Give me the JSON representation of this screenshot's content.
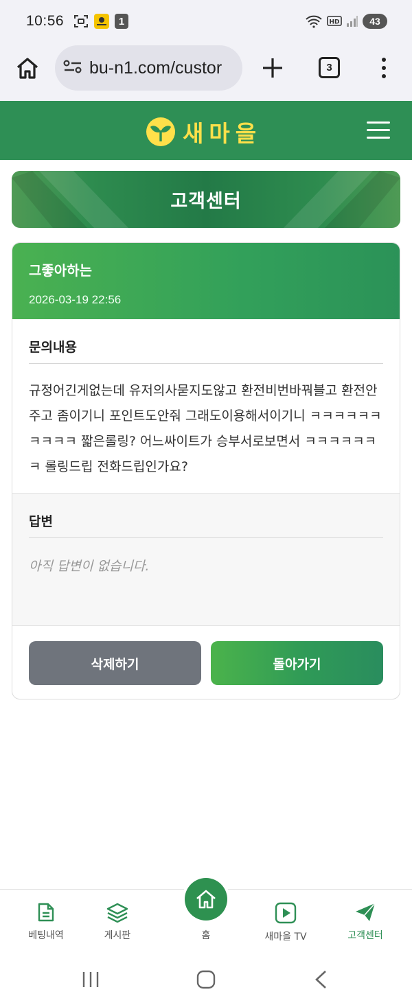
{
  "status_bar": {
    "time": "10:56",
    "notification_badge": "1",
    "battery": "43"
  },
  "browser": {
    "url": "bu-n1.com/custor",
    "tab_count": "3"
  },
  "site": {
    "logo_text": "새마을"
  },
  "banner": {
    "title": "고객센터"
  },
  "post": {
    "author": "그좋아하는",
    "date": "2026-03-19 22:56",
    "question_label": "문의내용",
    "question_body": "규정어긴게없는데 유저의사묻지도않고 환전비번바꿔블고 환전안주고 좀이기니 포인트도안줘 그래도이용해서이기니 ㅋㅋㅋㅋㅋㅋㅋㅋㅋㅋ 짧은롤링? 어느싸이트가 승부서로보면서 ㅋㅋㅋㅋㅋㅋㅋ 롤링드립 전화드립인가요?",
    "answer_label": "답변",
    "answer_body": "아직 답변이 없습니다."
  },
  "buttons": {
    "delete": "삭제하기",
    "back": "돌아가기"
  },
  "bottom_nav": {
    "items": [
      {
        "label": "베팅내역",
        "icon": "document-icon"
      },
      {
        "label": "게시판",
        "icon": "layers-icon"
      },
      {
        "label": "홈",
        "icon": "home-icon"
      },
      {
        "label": "새마을 TV",
        "icon": "play-icon"
      },
      {
        "label": "고객센터",
        "icon": "send-icon"
      }
    ]
  },
  "colors": {
    "brand_green": "#2e8f55",
    "logo_yellow": "#ffe04a",
    "delete_gray": "#6f747c"
  }
}
